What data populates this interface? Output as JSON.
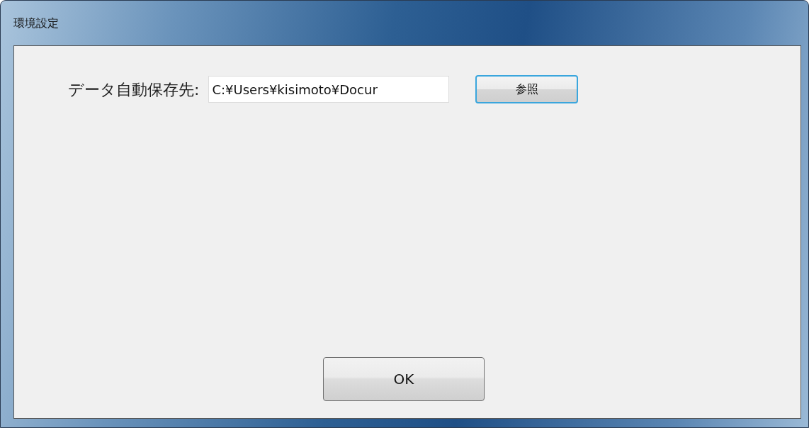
{
  "window": {
    "title": "環境設定"
  },
  "save_location": {
    "label": "データ自動保存先:",
    "value": "C:¥Users¥kisimoto¥Docur"
  },
  "browse_button": {
    "label": "参照"
  },
  "ok_button": {
    "label": "OK"
  }
}
